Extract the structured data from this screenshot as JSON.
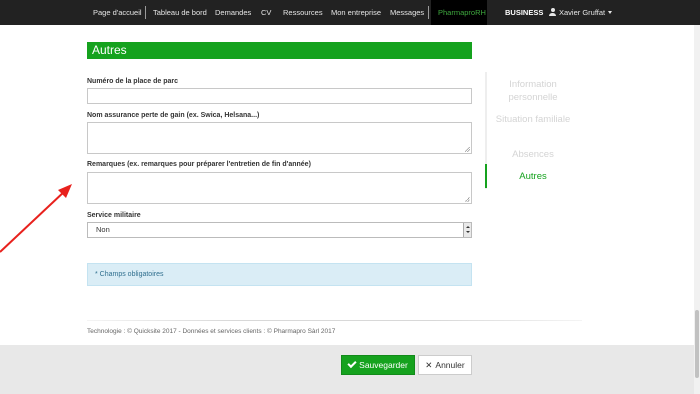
{
  "navbar": {
    "items": [
      "Page d'accueil",
      "Tableau de bord",
      "Demandes",
      "CV",
      "Ressources",
      "Mon entreprise",
      "Messages",
      "PharmaproRH",
      "BUSINESS"
    ],
    "user": "Xavier Gruffat"
  },
  "section": {
    "title": "Autres"
  },
  "form": {
    "parking_label": "Numéro de la place de parc",
    "parking_value": "",
    "insurance_label": "Nom assurance perte de gain (ex. Swica, Helsana...)",
    "insurance_value": "",
    "remarks_label": "Remarques (ex. remarques pour préparer l'entretien de fin d'année)",
    "remarks_value": "",
    "military_label": "Service militaire",
    "military_value": "Non"
  },
  "info": "* Champs obligatoires",
  "side_nav": {
    "items": [
      "Information personnelle",
      "Situation familiale",
      "Absences",
      "Autres"
    ],
    "active": "Autres"
  },
  "footer": "Technologie : © Quicksite 2017 - Données et services clients : © Pharmapro Sàrl 2017",
  "buttons": {
    "save": "Sauvegarder",
    "cancel": "Annuler"
  },
  "colors": {
    "accent": "#15a21e",
    "navbar": "#222222",
    "info_bg": "#daedf6",
    "annotation_arrow": "#e8211d"
  }
}
